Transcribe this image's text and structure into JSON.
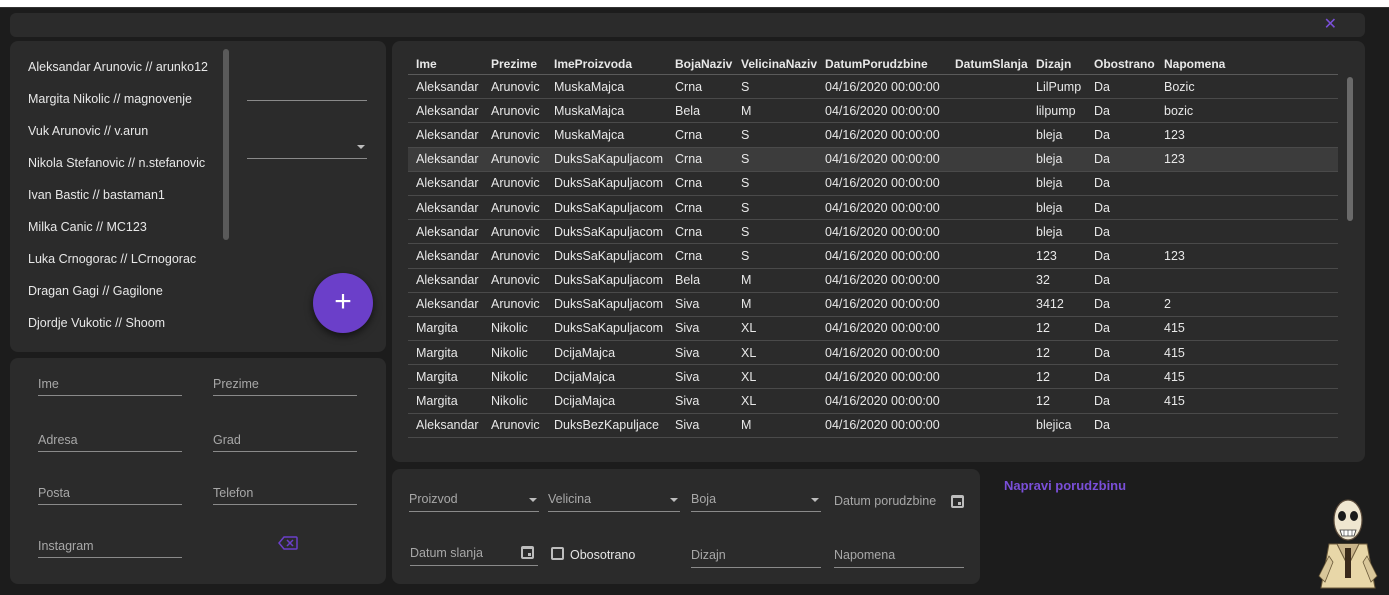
{
  "window": {
    "close_icon": "close-icon",
    "accent": "#6b3fc9"
  },
  "users": [
    "Aleksandar Arunovic // arunko12",
    "Margita Nikolic // magnovenje",
    "Vuk Arunovic // v.arun",
    "Nikola Stefanovic // n.stefanovic",
    "Ivan Bastic // bastaman1",
    "Milka Canic // MC123",
    "Luka Crnogorac // LCrnogorac",
    "Dragan Gagi // Gagilone",
    "Djordje Vukotic // Shoom"
  ],
  "add_button": {
    "label": "+"
  },
  "customer_form": {
    "ime": "Ime",
    "prezime": "Prezime",
    "adresa": "Adresa",
    "grad": "Grad",
    "posta": "Posta",
    "telefon": "Telefon",
    "instagram": "Instagram",
    "clear_icon": "backspace-icon"
  },
  "table": {
    "headers": [
      "Ime",
      "Prezime",
      "ImeProizvoda",
      "BojaNaziv",
      "VelicinaNaziv",
      "DatumPorudzbine",
      "DatumSlanja",
      "Dizajn",
      "Obostrano",
      "Napomena"
    ],
    "rows": [
      [
        "Aleksandar",
        "Arunovic",
        "MuskaMajca",
        "Crna",
        "S",
        "04/16/2020 00:00:00",
        "",
        "LilPump",
        "Da",
        "Bozic"
      ],
      [
        "Aleksandar",
        "Arunovic",
        "MuskaMajca",
        "Bela",
        "M",
        "04/16/2020 00:00:00",
        "",
        "lilpump",
        "Da",
        "bozic"
      ],
      [
        "Aleksandar",
        "Arunovic",
        "MuskaMajca",
        "Crna",
        "S",
        "04/16/2020 00:00:00",
        "",
        "bleja",
        "Da",
        "123"
      ],
      [
        "Aleksandar",
        "Arunovic",
        "DuksSaKapuljacom",
        "Crna",
        "S",
        "04/16/2020 00:00:00",
        "",
        "bleja",
        "Da",
        "123"
      ],
      [
        "Aleksandar",
        "Arunovic",
        "DuksSaKapuljacom",
        "Crna",
        "S",
        "04/16/2020 00:00:00",
        "",
        "bleja",
        "Da",
        ""
      ],
      [
        "Aleksandar",
        "Arunovic",
        "DuksSaKapuljacom",
        "Crna",
        "S",
        "04/16/2020 00:00:00",
        "",
        "bleja",
        "Da",
        ""
      ],
      [
        "Aleksandar",
        "Arunovic",
        "DuksSaKapuljacom",
        "Crna",
        "S",
        "04/16/2020 00:00:00",
        "",
        "bleja",
        "Da",
        ""
      ],
      [
        "Aleksandar",
        "Arunovic",
        "DuksSaKapuljacom",
        "Crna",
        "S",
        "04/16/2020 00:00:00",
        "",
        "123",
        "Da",
        "123"
      ],
      [
        "Aleksandar",
        "Arunovic",
        "DuksSaKapuljacom",
        "Bela",
        "M",
        "04/16/2020 00:00:00",
        "",
        "32",
        "Da",
        ""
      ],
      [
        "Aleksandar",
        "Arunovic",
        "DuksSaKapuljacom",
        "Siva",
        "M",
        "04/16/2020 00:00:00",
        "",
        "3412",
        "Da",
        "2"
      ],
      [
        "Margita",
        "Nikolic",
        "DuksSaKapuljacom",
        "Siva",
        "XL",
        "04/16/2020 00:00:00",
        "",
        "12",
        "Da",
        "415"
      ],
      [
        "Margita",
        "Nikolic",
        "DcijaMajca",
        "Siva",
        "XL",
        "04/16/2020 00:00:00",
        "",
        "12",
        "Da",
        "415"
      ],
      [
        "Margita",
        "Nikolic",
        "DcijaMajca",
        "Siva",
        "XL",
        "04/16/2020 00:00:00",
        "",
        "12",
        "Da",
        "415"
      ],
      [
        "Margita",
        "Nikolic",
        "DcijaMajca",
        "Siva",
        "XL",
        "04/16/2020 00:00:00",
        "",
        "12",
        "Da",
        "415"
      ],
      [
        "Aleksandar",
        "Arunovic",
        "DuksBezKapuljace",
        "Siva",
        "M",
        "04/16/2020 00:00:00",
        "",
        "blejica",
        "Da",
        ""
      ]
    ],
    "selected_row": 3
  },
  "order_form": {
    "proizvod": "Proizvod",
    "velicina": "Velicina",
    "boja": "Boja",
    "datum_porudzbine": "Datum porudzbine",
    "datum_slanja": "Datum slanja",
    "obostrano": "Obosotrano",
    "dizajn": "Dizajn",
    "napomena": "Napomena"
  },
  "napravi_porudzbinu": "Napravi porudzbinu"
}
